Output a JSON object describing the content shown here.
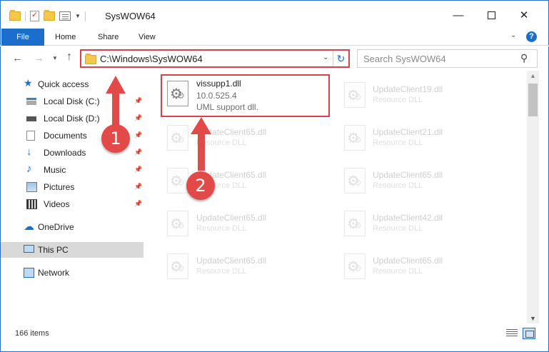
{
  "window": {
    "title": "SysWOW64",
    "minimize_glyph": "—",
    "close_glyph": "✕"
  },
  "ribbon": {
    "tabs": [
      "File",
      "Home",
      "Share",
      "View"
    ],
    "help_glyph": "?"
  },
  "navigation": {
    "address": "C:\\Windows\\SysWOW64",
    "search_placeholder": "Search SysWOW64"
  },
  "sidebar": {
    "items": [
      {
        "label": "Quick access",
        "icon": "star-icon"
      },
      {
        "label": "Local Disk (C:)",
        "icon": "drive-icon",
        "pinned": true
      },
      {
        "label": "Local Disk (D:)",
        "icon": "drive-icon",
        "pinned": true
      },
      {
        "label": "Documents",
        "icon": "documents-icon",
        "pinned": true
      },
      {
        "label": "Downloads",
        "icon": "downloads-icon",
        "pinned": true
      },
      {
        "label": "Music",
        "icon": "music-icon",
        "pinned": true
      },
      {
        "label": "Pictures",
        "icon": "pictures-icon",
        "pinned": true
      },
      {
        "label": "Videos",
        "icon": "videos-icon",
        "pinned": true
      },
      {
        "label": "OneDrive",
        "icon": "cloud-icon"
      },
      {
        "label": "This PC",
        "icon": "computer-icon",
        "selected": true
      },
      {
        "label": "Network",
        "icon": "network-icon"
      }
    ]
  },
  "files": [
    {
      "name": "vissupp1.dll",
      "version": "10.0.525.4",
      "description": "UML support dll.",
      "highlighted": true
    },
    {
      "name": "UpdateClient19.dll",
      "description": "Resource DLL"
    },
    {
      "name": "UpdateClient65.dll",
      "description": "Resource DLL"
    },
    {
      "name": "UpdateClient21.dll",
      "description": "Resource DLL"
    },
    {
      "name": "UpdateClient65.dll",
      "description": "Resource DLL"
    },
    {
      "name": "UpdateClient65.dll",
      "description": "Resource DLL"
    },
    {
      "name": "UpdateClient65.dll",
      "description": "Resource DLL"
    },
    {
      "name": "UpdateClient42.dll",
      "description": "Resource DLL"
    },
    {
      "name": "UpdateClient65.dll",
      "description": "Resource DLL"
    },
    {
      "name": "UpdateClient65.dll",
      "description": "Resource DLL"
    }
  ],
  "status": {
    "item_count": "166 items"
  },
  "annotations": {
    "step1": "1",
    "step2": "2",
    "color": "#e24a4a"
  }
}
